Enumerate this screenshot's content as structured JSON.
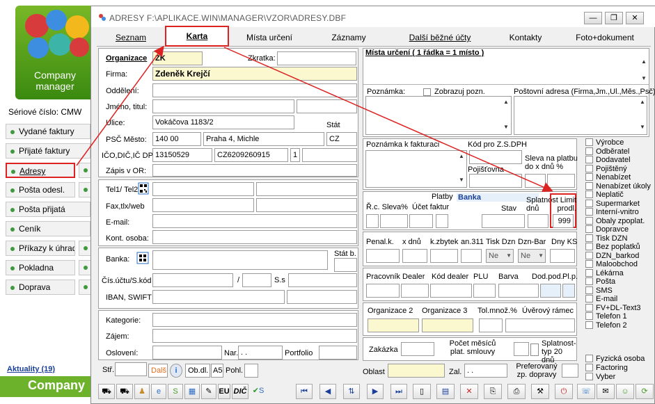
{
  "background_app": {
    "logo_text": "Company manager",
    "serial_label": "Sériové číslo: CMW",
    "sidebar": [
      {
        "label": "Vydané faktury"
      },
      {
        "label": "Přijaté faktury"
      },
      {
        "label": "Adresy"
      },
      {
        "label": "Pošta odesl."
      },
      {
        "label": "Pošta přijatá"
      },
      {
        "label": "Ceník"
      },
      {
        "label": "Příkazy k úhradě"
      },
      {
        "label": "Pokladna"
      },
      {
        "label": "Doprava"
      }
    ],
    "aktuality": "Aktuality (19)",
    "company_band": "Company"
  },
  "window": {
    "title": "ADRESY F:\\APLIKACE.WIN\\MANAGER\\VZOR\\ADRESY.DBF",
    "controls": {
      "minimize": "—",
      "restore": "❐",
      "close": "✕"
    },
    "tabs": [
      {
        "label": "Seznam"
      },
      {
        "label": "Karta"
      },
      {
        "label": "Místa určení"
      },
      {
        "label": "Záznamy"
      },
      {
        "label": "Další běžné účty"
      },
      {
        "label": "Kontakty"
      },
      {
        "label": "Foto+dokument"
      }
    ]
  },
  "form": {
    "organizace_label": "Organizace",
    "organizace_value": "ZK",
    "zkratka_label": "Zkratka:",
    "zkratka_value": "",
    "firma_label": "Firma:",
    "firma_value": "Zdeněk Krejčí",
    "oddeleni_label": "Oddělení:",
    "jmeno_label": "Jméno, titul:",
    "ulice_label": "Ulice:",
    "ulice_value": "Vokáčova 1183/2",
    "stat_label": "Stát",
    "psc_label": "PSČ  Město:",
    "psc_value": "140  00",
    "mesto_value": "Praha 4, Michle",
    "stat_value": "CZ",
    "ico_label": "IČO,DIČ,IČ DPH",
    "ico_value": "13150529",
    "dic_value": "CZ6209260915",
    "icdph_value": "1",
    "zapis_label": "Zápis v OR:",
    "tel_label": "Tel1/ Tel2:",
    "fax_label": "Fax,tlx/web",
    "email_label": "E-mail:",
    "kont_label": "Kont. osoba:",
    "banka_label": "Banka:",
    "statb_label": "Stát b.",
    "cisucet_label": "Čís.účtu/S.kód",
    "lomeno": "/",
    "ss_label": "S.s",
    "iban_label": "IBAN, SWIFT",
    "kategorie_label": "Kategorie:",
    "zajem_label": "Zájem:",
    "osloveni_label": "Oslovení:",
    "nar_label": "Nar.",
    "nar_value": " .  .",
    "portfolio_label": "Portfolio",
    "str_label": "Stř.",
    "dalsi_label": "Další",
    "info_label": "i",
    "obdl_label": "Ob.dl.",
    "a5_label": "A5",
    "pohl_label": "Pohl."
  },
  "right": {
    "mista_label": "Místa určení ( 1 řádka = 1 místo )",
    "poznamka_label": "Poznámka:",
    "zobrazuj_label": "Zobrazuj pozn.",
    "postovni_label": "Poštovní adresa (Firma,Jm.,Ul.,Měs.,Psč)",
    "pozn_fakt_label": "Poznámka k fakturaci",
    "kod_zs_label": "Kód pro Z.S.DPH",
    "pojistovna_label": "Pojišťovna",
    "sleva_label": "Sleva na platbu do x dnů   %",
    "platby_label": "Platby",
    "banka_label": "Banka",
    "rc_label": "Ř.c. Sleva%",
    "ucet_label": "Účet faktur",
    "stav_label": "Stav",
    "splatnost_label": "Splatnost dnů",
    "limit_label": "Limit prodl.",
    "limit_value": "999",
    "penal_label": "Penal.k.",
    "xdnu_label": "x dnů",
    "kzbytek_label": "k.zbytek",
    "an311_label": "an.311",
    "tiskdzn_label": "Tisk Dzn",
    "tiskdzn_value": "Ne",
    "dznbar_label": "Dzn-Bar",
    "dznbar_value": "Ne",
    "dnyks_label": "Dny KS",
    "pracovnik_label": "Pracovník",
    "dealer_label": "Dealer",
    "koddealer_label": "Kód dealer",
    "plu_label": "PLU",
    "barva_label": "Barva",
    "dodpod_label": "Dod.pod.",
    "plp_label": "Pl.p.",
    "org2_label": "Organizace 2",
    "org3_label": "Organizace 3",
    "tolmnoz_label": "Tol.množ.%",
    "uverovy_label": "Úvěrový rámec",
    "zakazka_label": "Zakázka",
    "pocet_label": "Počet měsíců plat. smlouvy",
    "splatnost_typ_label": "Splatnost-typ 20 dnů",
    "oblast_label": "Oblast",
    "zal_label": "Zal.",
    "zal_value": " .  .",
    "preferovany_label": "Preferovaný zp. dopravy"
  },
  "checklist": [
    "Výrobce",
    "Odběratel",
    "Dodavatel",
    "Pojištěný",
    "Nenabízet",
    "Nenabízet úkoly",
    "Neplatič",
    "Supermarket",
    "Interní-vnitro",
    "Obaly zpoplat.",
    "Dopravce",
    "Tisk DZN",
    "Bez poplatků",
    "DZN_barkod",
    "Maloobchod",
    "Lékárna",
    "Pošta",
    "SMS",
    "E-mail",
    "FV+DL-Text3",
    "Telefon 1",
    "Telefon 2"
  ],
  "checklist2": [
    "Fyzická osoba",
    "Factoring",
    "Vyber"
  ],
  "toolbar": {
    "eu": "EU",
    "dic": "DIČ",
    "s": "S"
  },
  "colors": {
    "accent_red": "#dd2222",
    "yellow_field": "#fbf7cf",
    "green": "#6db22b"
  }
}
